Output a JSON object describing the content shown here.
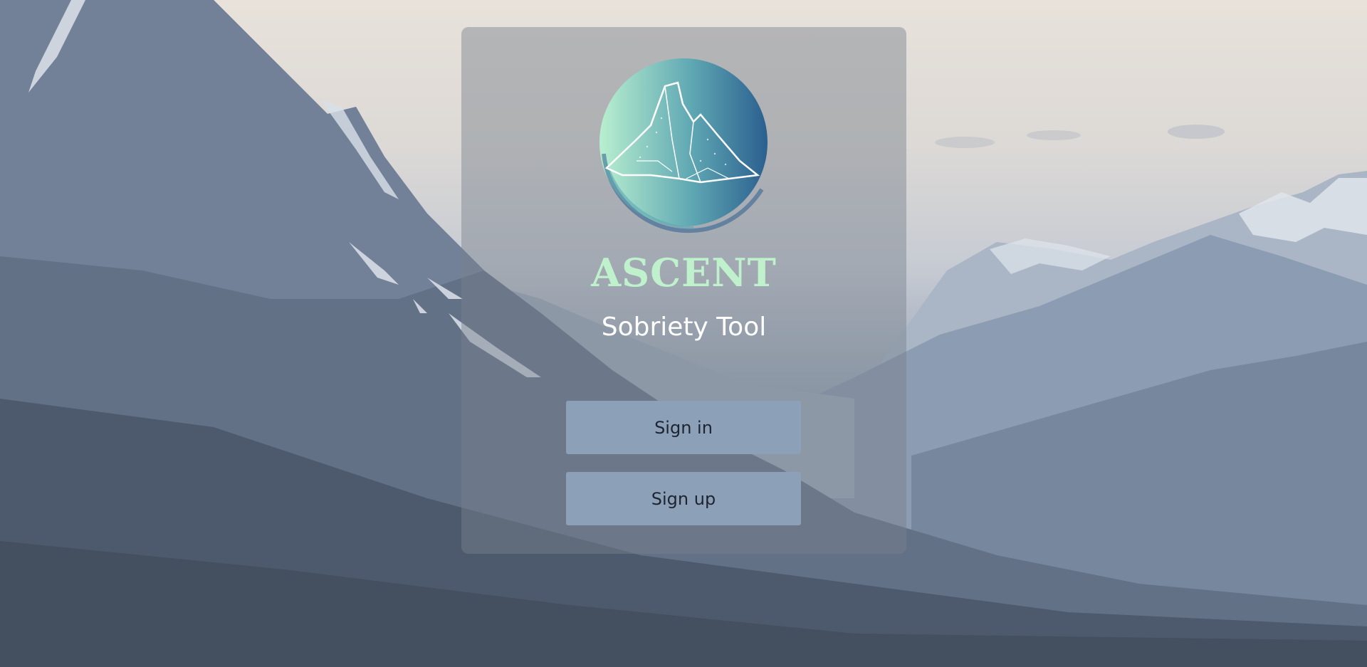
{
  "brand": {
    "name": "ASCENT",
    "tagline": "Sobriety Tool",
    "logo_icon": "mountain-circle-logo",
    "accent_color": "#bff2cc"
  },
  "actions": {
    "sign_in_label": "Sign in",
    "sign_up_label": "Sign up",
    "button_color": "#8ca0b8"
  }
}
